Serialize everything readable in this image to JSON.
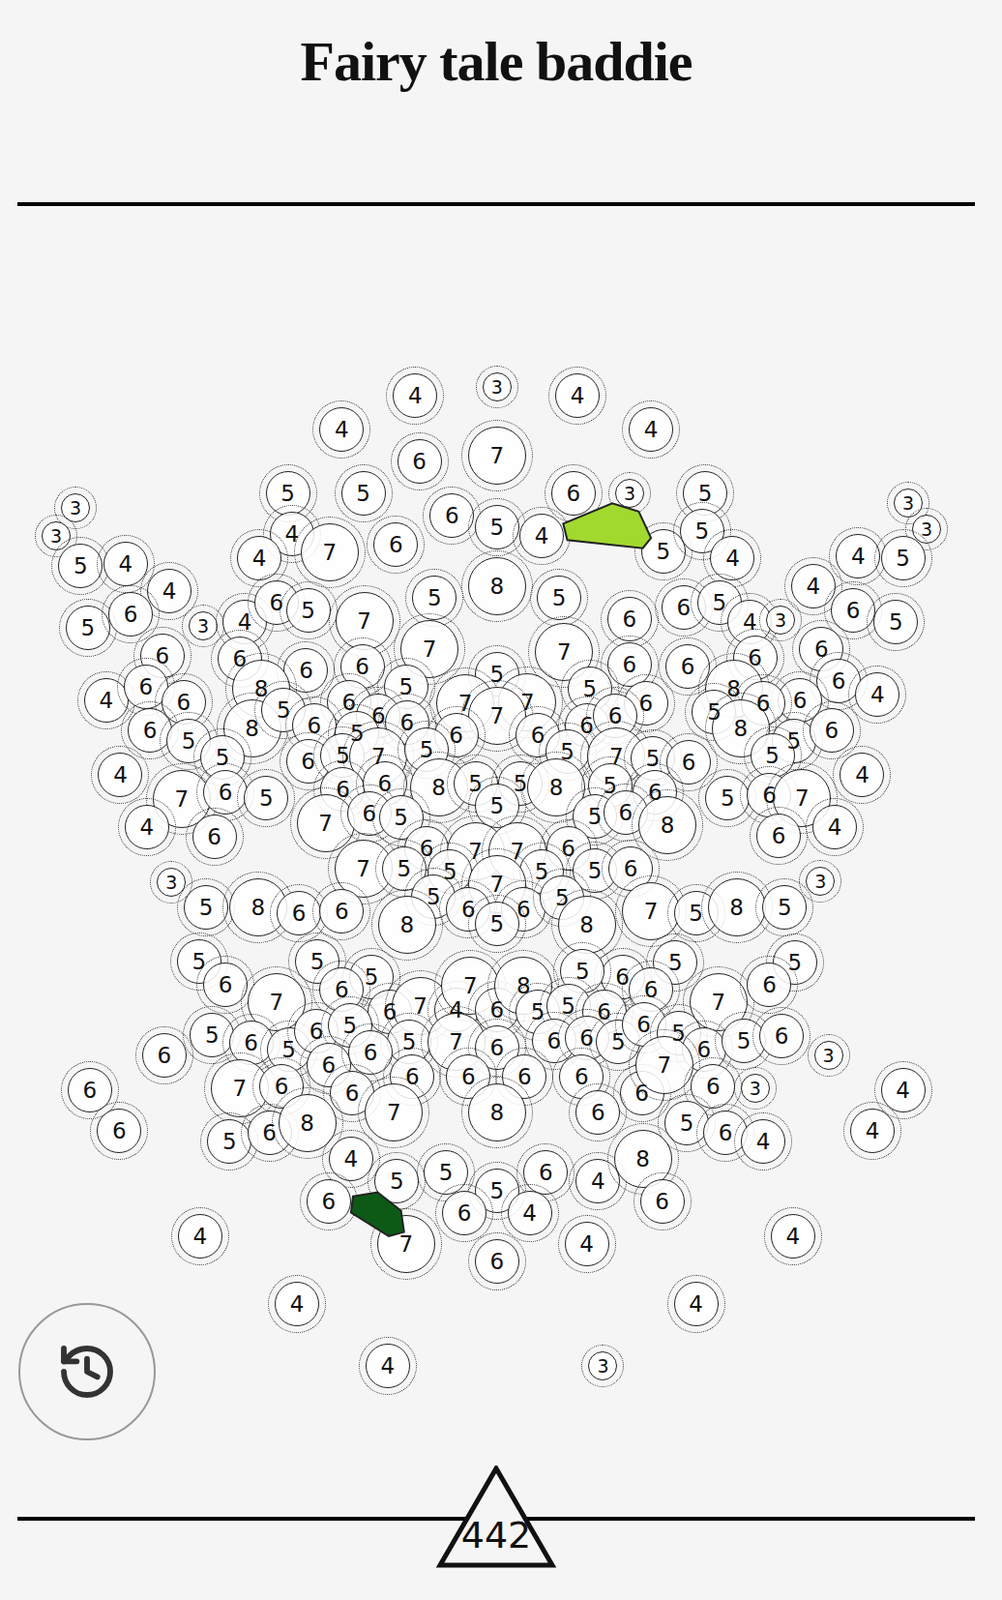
{
  "title": "Fairy tale baddie",
  "score": "442",
  "circles": [
    "4",
    "3",
    "4",
    "4",
    "4",
    "6",
    "7",
    "5",
    "5",
    "6",
    "3",
    "5",
    "3",
    "3",
    "3",
    "3",
    "6",
    "5",
    "4",
    "5",
    "5",
    "4",
    "7",
    "6",
    "4",
    "5",
    "4",
    "4",
    "4",
    "5",
    "8",
    "5",
    "5",
    "4",
    "4",
    "5",
    "6",
    "3",
    "4",
    "6",
    "5",
    "7",
    "6",
    "6",
    "5",
    "4",
    "3",
    "6",
    "5",
    "7",
    "7",
    "6",
    "6",
    "6",
    "6",
    "6",
    "6",
    "6",
    "4",
    "6",
    "6",
    "6",
    "8",
    "5",
    "5",
    "7",
    "7",
    "5",
    "6",
    "8",
    "6",
    "4",
    "6",
    "6",
    "6",
    "6",
    "7",
    "6",
    "6",
    "5",
    "6",
    "5",
    "8",
    "5",
    "6",
    "5",
    "6",
    "6",
    "6",
    "8",
    "5",
    "6",
    "5",
    "6",
    "5",
    "7",
    "5",
    "5",
    "7",
    "5",
    "6",
    "5",
    "4",
    "4",
    "7",
    "6",
    "5",
    "6",
    "6",
    "8",
    "5",
    "5",
    "8",
    "5",
    "6",
    "5",
    "6",
    "7",
    "4",
    "6",
    "7",
    "6",
    "5",
    "5",
    "5",
    "6",
    "8",
    "6",
    "4",
    "6",
    "7",
    "7",
    "6",
    "3",
    "7",
    "5",
    "5",
    "5",
    "5",
    "6",
    "3",
    "7",
    "5",
    "6",
    "6",
    "5",
    "5",
    "8",
    "6",
    "6",
    "8",
    "5",
    "8",
    "7",
    "5",
    "8",
    "5",
    "5",
    "5",
    "5",
    "6",
    "5",
    "5",
    "5",
    "6",
    "7",
    "6",
    "6",
    "7",
    "4",
    "7",
    "6",
    "8",
    "5",
    "5",
    "6",
    "6",
    "7",
    "6",
    "6",
    "5",
    "6",
    "5",
    "6",
    "5",
    "5",
    "7",
    "6",
    "6",
    "6",
    "5",
    "6",
    "5",
    "6",
    "5",
    "6",
    "3",
    "6",
    "7",
    "6",
    "6",
    "6",
    "6",
    "6",
    "6",
    "6",
    "6",
    "6",
    "7",
    "6",
    "3",
    "4",
    "6",
    "5",
    "6",
    "8",
    "7",
    "8",
    "6",
    "5",
    "6",
    "4",
    "4",
    "4",
    "5",
    "5",
    "5",
    "6",
    "4",
    "8",
    "6",
    "6",
    "6",
    "4",
    "7",
    "6",
    "4",
    "4",
    "4",
    "4",
    "4",
    "4",
    "3"
  ],
  "regions": [
    {
      "color": "#a2d92e"
    },
    {
      "color": "#0c5a16"
    }
  ]
}
